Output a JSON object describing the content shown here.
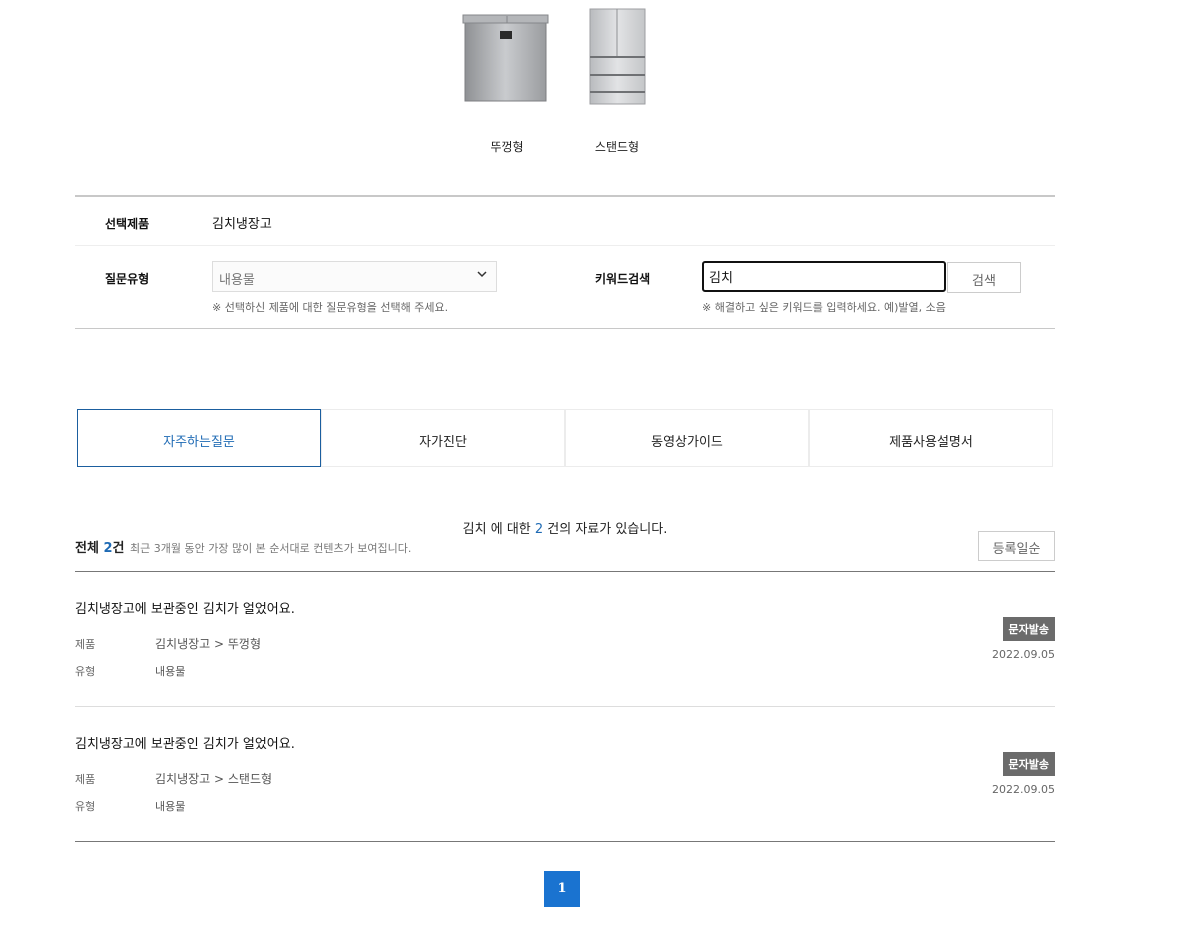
{
  "products": [
    {
      "label": "뚜껑형"
    },
    {
      "label": "스탠드형"
    }
  ],
  "filter": {
    "selected_label": "선택제품",
    "selected_value": "김치냉장고",
    "type_label": "질문유형",
    "type_value": "내용물",
    "type_hint": "※ 선택하신 제품에 대한 질문유형을 선택해 주세요.",
    "keyword_label": "키워드검색",
    "keyword_value": "김치",
    "keyword_hint": "※ 해결하고 싶은 키워드를 입력하세요. 예)발열, 소음",
    "search_button": "검색"
  },
  "tabs": [
    {
      "label": "자주하는질문",
      "active": true
    },
    {
      "label": "자가진단"
    },
    {
      "label": "동영상가이드"
    },
    {
      "label": "제품사용설명서"
    }
  ],
  "result": {
    "keyword": "김치",
    "mid": " 에 대한 ",
    "count": "2",
    "suffix": " 건의 자료가 있습니다."
  },
  "summary": {
    "total_label": "전체 ",
    "total_count": "2",
    "total_unit": "건",
    "description": "최근 3개월 동안 가장 많이 본 순서대로 컨텐츠가 보여집니다.",
    "sort_button": "등록일순"
  },
  "items": [
    {
      "title": "김치냉장고에 보관중인 김치가 얼었어요.",
      "product_key": "제품",
      "product_value": "김치냉장고 > 뚜껑형",
      "type_key": "유형",
      "type_value": "내용물",
      "badge": "문자발송",
      "date": "2022.09.05"
    },
    {
      "title": "김치냉장고에 보관중인 김치가 얼었어요.",
      "product_key": "제품",
      "product_value": "김치냉장고 > 스탠드형",
      "type_key": "유형",
      "type_value": "내용물",
      "badge": "문자발송",
      "date": "2022.09.05"
    }
  ],
  "pagination": {
    "current": "1"
  },
  "colors": {
    "accent": "#1e6ab4",
    "page_button": "#1a73d0",
    "badge": "#6b6b6b"
  }
}
